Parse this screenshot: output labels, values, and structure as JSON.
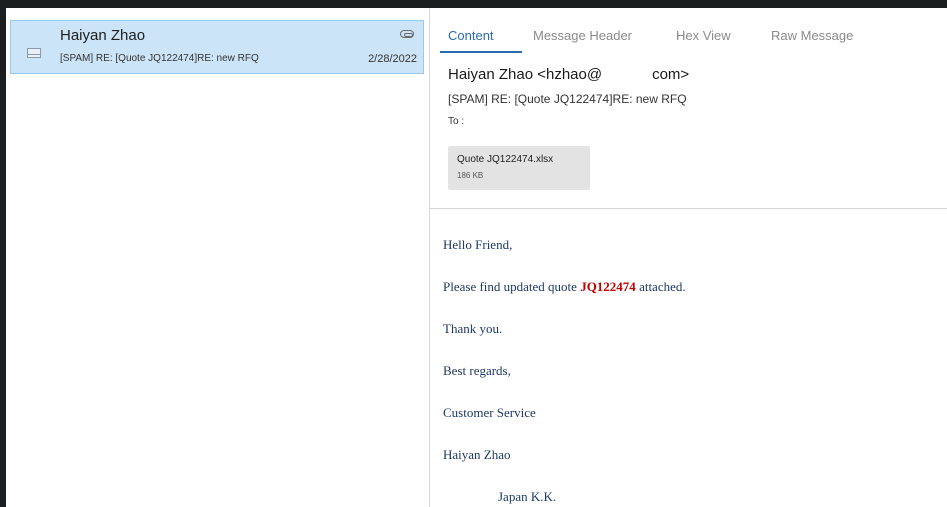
{
  "message_list": {
    "items": [
      {
        "sender": "Haiyan Zhao",
        "subject": "[SPAM] RE: [Quote JQ122474]RE: new RFQ",
        "date": "2/28/2022",
        "icon": "envelope-icon",
        "attachment_icon": "paperclip-icon"
      }
    ]
  },
  "tabs": [
    {
      "label": "Content",
      "active": true
    },
    {
      "label": "Message Header",
      "active": false
    },
    {
      "label": "Hex View",
      "active": false
    },
    {
      "label": "Raw Message",
      "active": false
    }
  ],
  "message": {
    "from": "Haiyan Zhao <hzhao@            com>",
    "subject": "[SPAM] RE: [Quote JQ122474]RE: new RFQ",
    "to_label": "To :",
    "attachment": {
      "name": "Quote JQ122474.xlsx",
      "size": "186 KB"
    }
  },
  "body": {
    "greeting": "Hello Friend,",
    "line_pre": "Please find updated quote ",
    "quote_id": "JQ122474",
    "line_post": " attached.",
    "thanks": "Thank you.",
    "regards": "Best regards,",
    "dept": "Customer Service",
    "name": "Haiyan Zhao",
    "company": "Japan K.K."
  },
  "colors": {
    "selection_bg": "#cce4f7",
    "accent": "#2b6cb0",
    "body_text": "#1f3864",
    "quote_highlight": "#c00000"
  }
}
